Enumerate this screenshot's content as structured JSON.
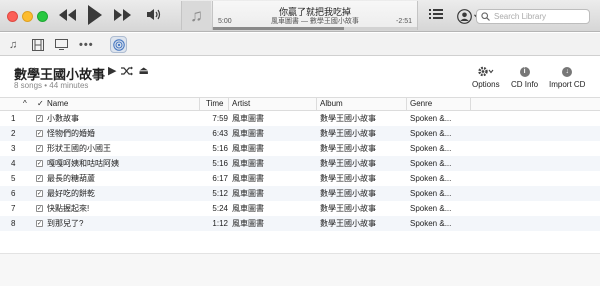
{
  "player": {
    "now_playing_title": "你贏了就把我吃掉",
    "now_playing_subtitle": "風車圖書 — 數學王國小故事",
    "elapsed": "5:00",
    "remaining": "-2:51",
    "progress": 0.64
  },
  "search": {
    "placeholder": "Search Library"
  },
  "album": {
    "title": "數學王國小故事",
    "meta": "8 songs • 44 minutes",
    "options_label": "Options",
    "cdinfo_label": "CD Info",
    "import_label": "Import CD"
  },
  "table": {
    "headers": {
      "sort": "^",
      "check": "✓",
      "name": "Name",
      "time": "Time",
      "artist": "Artist",
      "album": "Album",
      "genre": "Genre"
    },
    "rows": [
      {
        "num": "1",
        "name": "小數故事",
        "time": "7:59",
        "artist": "風車圖書",
        "album": "數學王國小故事",
        "genre": "Spoken &..."
      },
      {
        "num": "2",
        "name": "怪物們的婚婚",
        "time": "6:43",
        "artist": "風車圖書",
        "album": "數學王國小故事",
        "genre": "Spoken &..."
      },
      {
        "num": "3",
        "name": "形狀王國的小國王",
        "time": "5:16",
        "artist": "風車圖書",
        "album": "數學王國小故事",
        "genre": "Spoken &..."
      },
      {
        "num": "4",
        "name": "嘎嘎呵姨和咕咕阿姨",
        "time": "5:16",
        "artist": "風車圖書",
        "album": "數學王國小故事",
        "genre": "Spoken &..."
      },
      {
        "num": "5",
        "name": "最長的糖葫蘆",
        "time": "6:17",
        "artist": "風車圖書",
        "album": "數學王國小故事",
        "genre": "Spoken &..."
      },
      {
        "num": "6",
        "name": "最好吃的餅乾",
        "time": "5:12",
        "artist": "風車圖書",
        "album": "數學王國小故事",
        "genre": "Spoken &..."
      },
      {
        "num": "7",
        "name": "快點握起來!",
        "time": "5:24",
        "artist": "風車圖書",
        "album": "數學王國小故事",
        "genre": "Spoken &..."
      },
      {
        "num": "8",
        "name": "到那兒了?",
        "time": "1:12",
        "artist": "風車圖書",
        "album": "數學王國小故事",
        "genre": "Spoken &..."
      }
    ]
  }
}
